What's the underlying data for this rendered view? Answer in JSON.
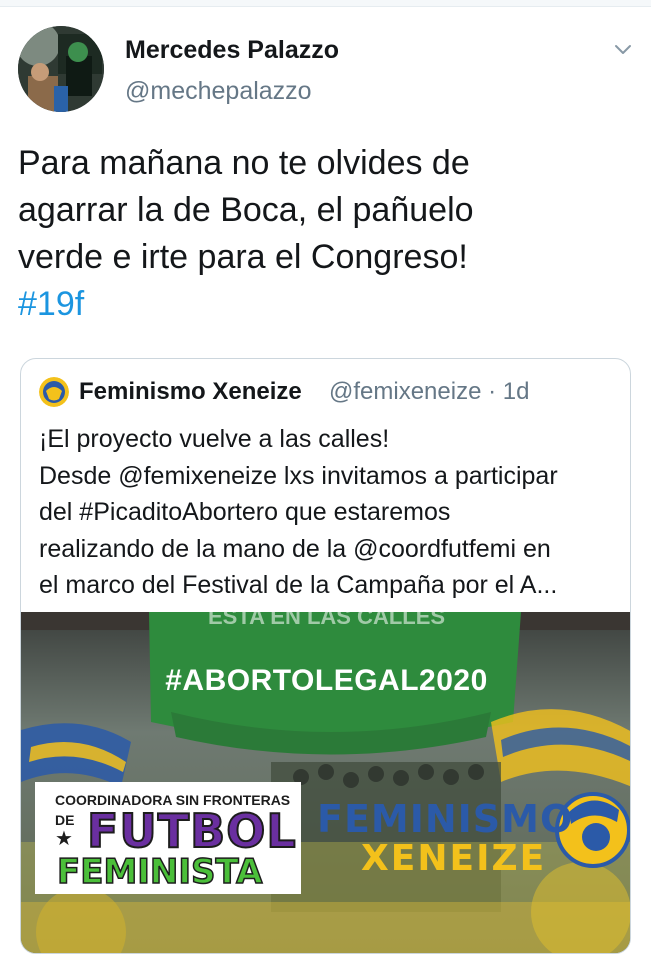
{
  "tweet": {
    "author_name": "Mercedes Palazzo",
    "author_handle": "@mechepalazzo",
    "text_lines": [
      "Para mañana no te olvides de",
      "agarrar la de Boca, el pañuelo",
      "verde e irte para el Congreso!"
    ],
    "hashtag": "#19f",
    "menu_icon": "chevron-down-icon"
  },
  "quoted": {
    "author_name": "Feminismo Xeneize",
    "author_handle": "@femixeneize",
    "time": "· 1d",
    "text_lines": [
      "¡El proyecto vuelve a las calles!",
      "Desde @femixeneize lxs invitamos a participar",
      "del #PicaditoAbortero que estaremos",
      "realizando de la mano de la @coordfutfemi en",
      "el marco del Festival de la Campaña por el A..."
    ],
    "media": {
      "banner_top_text": "ESTA EN LAS CALLES",
      "banner_hashtag": "#ABORTOLEGAL2020",
      "left_logo": {
        "line1": "COORDINADORA SIN FRONTERAS",
        "de": "DE",
        "star": "★",
        "line2": "FUTBOL",
        "line3": "FEMINISTA"
      },
      "right_logo": {
        "line1": "FEMINISMO",
        "line2": "XENEIZE"
      }
    }
  },
  "colors": {
    "link_blue": "#1b95e0",
    "secondary_text": "#657786",
    "boca_blue": "#2b5aa8",
    "boca_yellow": "#f3c11b",
    "green_banner": "#2e8b3d"
  }
}
